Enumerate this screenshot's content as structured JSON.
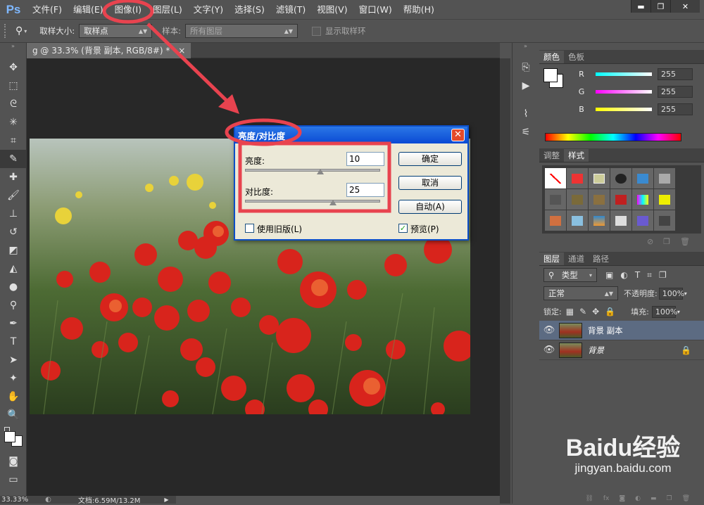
{
  "app": {
    "logo": "Ps"
  },
  "menu": [
    "文件(F)",
    "编辑(E)",
    "图像(I)",
    "图层(L)",
    "文字(Y)",
    "选择(S)",
    "滤镜(T)",
    "视图(V)",
    "窗口(W)",
    "帮助(H)"
  ],
  "window_controls": {
    "minimize": "▬",
    "restore": "❐",
    "close": "✕"
  },
  "options": {
    "sample_size_label": "取样大小:",
    "sample_size_value": "取样点",
    "sample_label": "样本:",
    "sample_value": "所有图层",
    "show_ring_label": "显示取样环"
  },
  "document": {
    "tab_title": "g @ 33.3% (背景 副本, RGB/8#) *",
    "tab_close": "×"
  },
  "status": {
    "zoom": "33.33%",
    "doc_size": "文档:6.59M/13.2M"
  },
  "color_panel": {
    "tabs": [
      "颜色",
      "色板"
    ],
    "channels": [
      {
        "label": "R",
        "value": "255"
      },
      {
        "label": "G",
        "value": "255"
      },
      {
        "label": "B",
        "value": "255"
      }
    ]
  },
  "styles_panel": {
    "tabs": [
      "调整",
      "样式"
    ]
  },
  "layers_panel": {
    "tabs": [
      "图层",
      "通道",
      "路径"
    ],
    "filter_kind": "类型",
    "blend_mode": "正常",
    "opacity_label": "不透明度:",
    "opacity_value": "100%",
    "lock_label": "锁定:",
    "fill_label": "填充:",
    "fill_value": "100%",
    "layers": [
      {
        "name": "背景 副本",
        "selected": true
      },
      {
        "name": "背景",
        "selected": false
      }
    ]
  },
  "dialog": {
    "title": "亮度/对比度",
    "brightness_label": "亮度:",
    "brightness_value": "10",
    "contrast_label": "对比度:",
    "contrast_value": "25",
    "ok_label": "确定",
    "cancel_label": "取消",
    "auto_label": "自动(A)",
    "legacy_label": "使用旧版(L)",
    "legacy_checked": false,
    "preview_label": "预览(P)",
    "preview_checked": true
  },
  "watermark": {
    "brand": "Baidu经验",
    "url": "jingyan.baidu.com"
  },
  "colors": {
    "annotation_red": "#e8434f",
    "dialog_title_blue": "#0a4ad4",
    "panel_bg": "#535353"
  }
}
